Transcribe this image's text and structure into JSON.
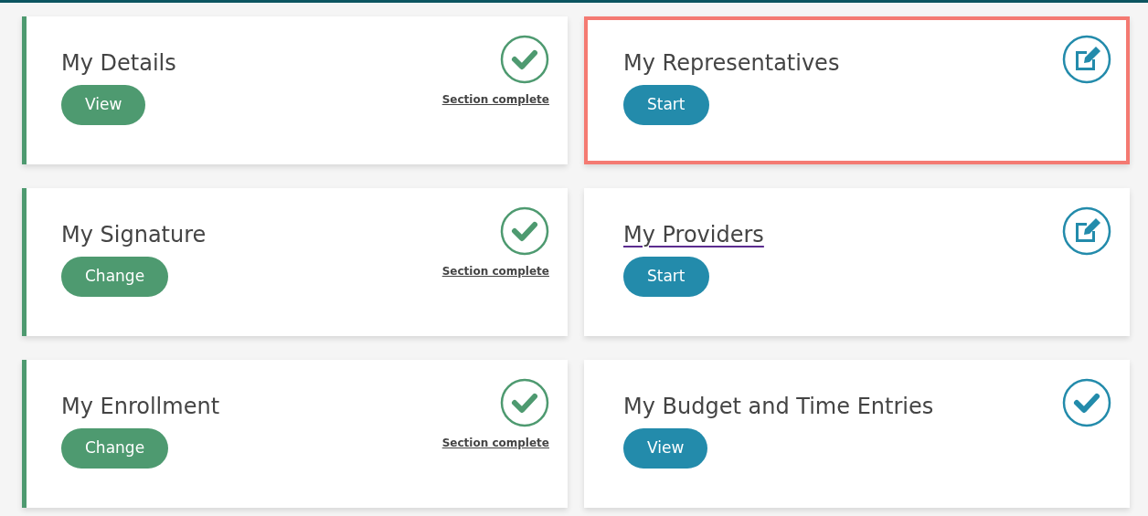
{
  "cards": [
    {
      "title": "My Details",
      "title_link": false,
      "button": "View",
      "kind": "check",
      "complete": true,
      "status_label": "Section complete",
      "highlighted": false
    },
    {
      "title": "My Representatives",
      "title_link": false,
      "button": "Start",
      "kind": "edit",
      "complete": false,
      "highlighted": true
    },
    {
      "title": "My Signature",
      "title_link": false,
      "button": "Change",
      "kind": "check",
      "complete": true,
      "status_label": "Section complete",
      "highlighted": false
    },
    {
      "title": "My Providers",
      "title_link": true,
      "button": "Start",
      "kind": "edit",
      "complete": false,
      "highlighted": false
    },
    {
      "title": "My Enrollment",
      "title_link": false,
      "button": "Change",
      "kind": "check",
      "complete": true,
      "status_label": "Section complete",
      "highlighted": false
    },
    {
      "title": "My Budget and Time Entries",
      "title_link": false,
      "button": "View",
      "kind": "check",
      "complete": false,
      "highlighted": false
    }
  ]
}
